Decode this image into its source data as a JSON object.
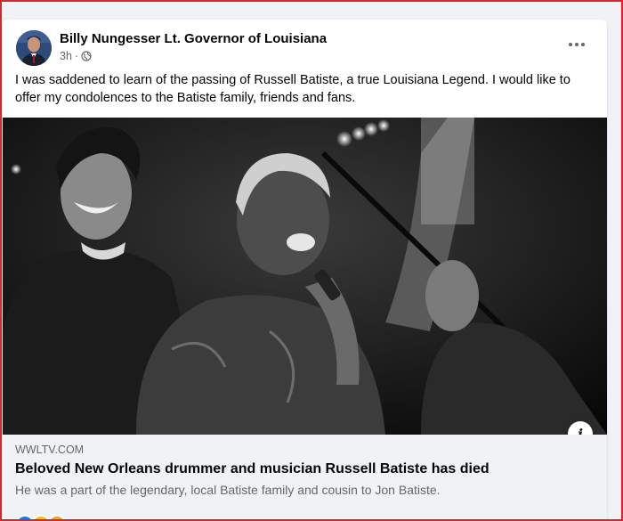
{
  "post": {
    "author": "Billy Nungesser Lt. Governor of Louisiana",
    "time": "3h",
    "privacy_icon": "globe-icon",
    "more_icon": "more-options-icon",
    "text": "I was saddened to learn of the passing of Russell Batiste, a true Louisiana Legend. I would like to offer my condolences to the Batiste family, friends and fans."
  },
  "link": {
    "domain": "WWLTV.COM",
    "headline": "Beloved New Orleans drummer and musician Russell Batiste has died",
    "description": "He was a part of the legendary, local Batiste family and cousin to Jon Batiste.",
    "info_icon": "i"
  },
  "colors": {
    "frame": "#d9262a",
    "page_bg": "#f0f2f5",
    "text_primary": "#050505",
    "text_secondary": "#65676b"
  }
}
